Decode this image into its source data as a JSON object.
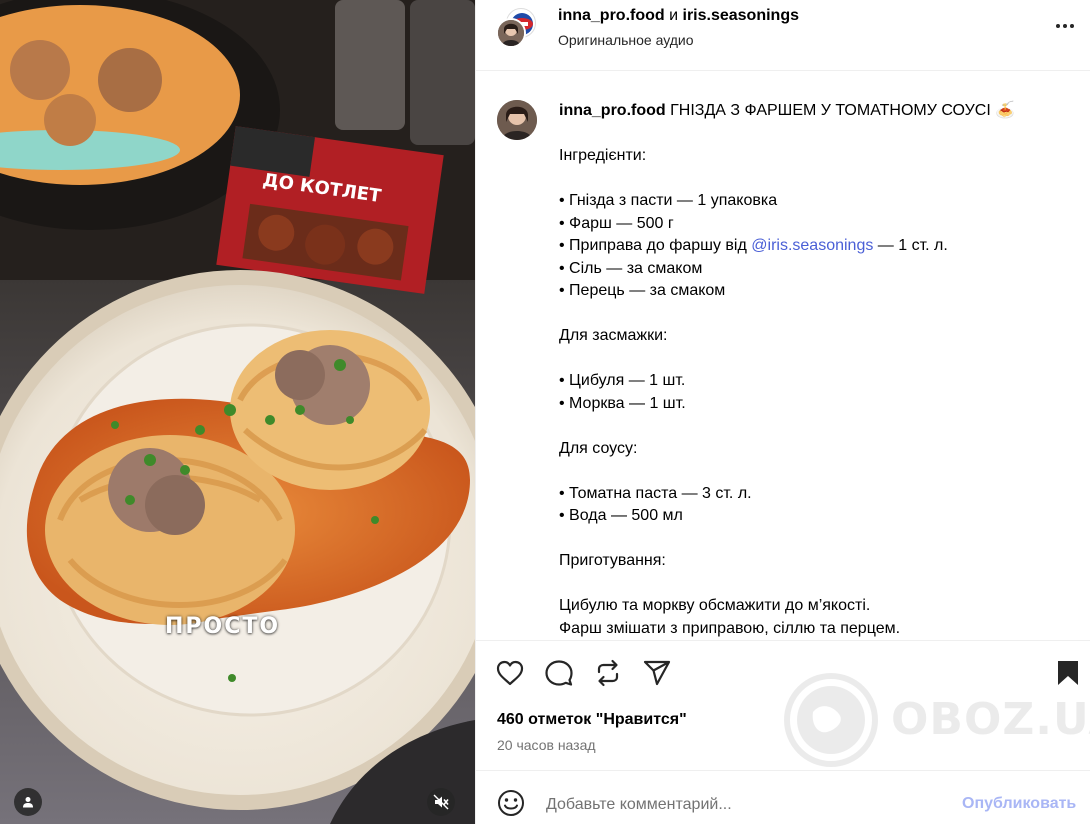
{
  "media": {
    "caption": "ПРОСТО",
    "package_text": "ДО КОТЛЕТ"
  },
  "header": {
    "author": "inna_pro.food",
    "conjunction": "и",
    "coauthor": "iris.seasonings",
    "audio": "Оригинальное аудио"
  },
  "post": {
    "author": "inna_pro.food",
    "title": "ГНІЗДА З ФАРШЕМ У ТОМАТНОМУ СОУСІ 🍝",
    "lines": [
      "",
      "Інгредієнти:",
      "",
      "• Гнізда з пасти — 1 упаковка",
      "• Фарш — 500 г",
      "",
      "• Сіль — за смаком",
      "• Перець — за смаком",
      "",
      "Для засмажки:",
      "",
      "• Цибуля — 1 шт.",
      "• Морква — 1 шт.",
      "",
      "Для соусу:",
      "",
      "• Томатна паста — 3 ст. л.",
      "• Вода — 500 мл",
      "",
      "Приготування:",
      "",
      "Цибулю та моркву обсмажити до м’якості.",
      "Фарш змішати з приправою, сіллю та перцем."
    ],
    "mention_line": {
      "before": "• Приправа до фаршу від ",
      "mention": "@iris.seasonings",
      "after": " — 1 ст. л."
    }
  },
  "stats": {
    "likes": "460 отметок \"Нравится\"",
    "time": "20 часов назад"
  },
  "composer": {
    "placeholder": "Добавьте комментарий...",
    "publish": "Опубликовать"
  },
  "watermark": "OBOZ.UA",
  "colors": {
    "mention": "#4a5fd6",
    "publish_disabled": "#a9b6f5",
    "secondary_text": "#737373"
  }
}
